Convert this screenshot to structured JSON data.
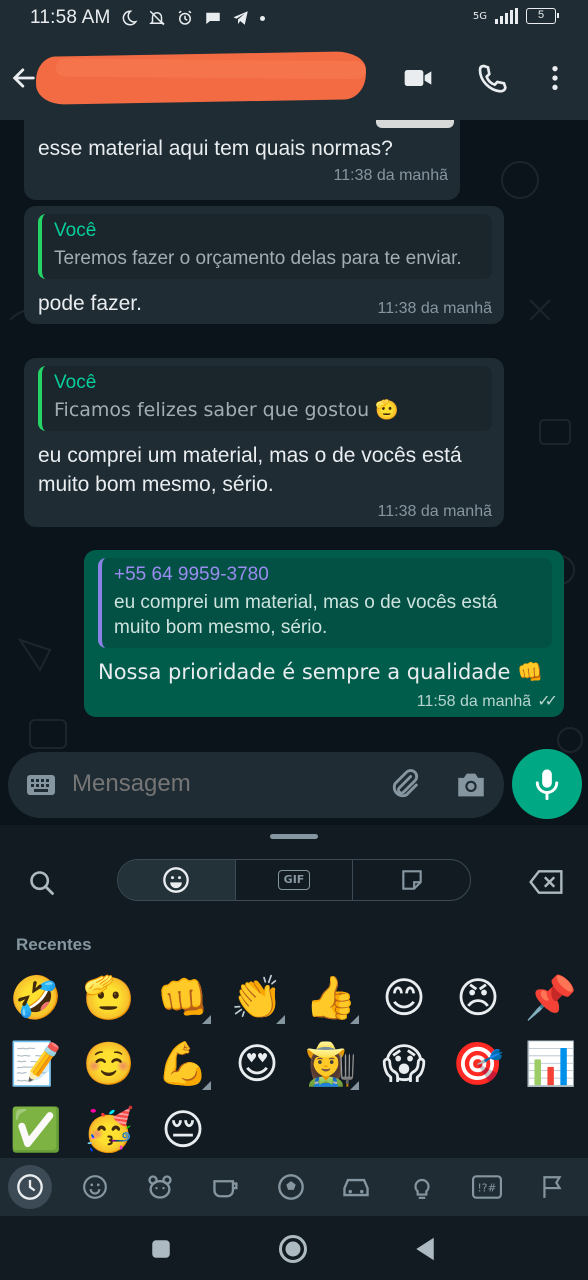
{
  "status_bar": {
    "time": "11:58 AM",
    "network": "5G",
    "battery": "5"
  },
  "header": {
    "contact_name_redacted": true
  },
  "messages": [
    {
      "direction": "in",
      "text": "esse material aqui tem quais normas?",
      "time": "11:38 da manhã"
    },
    {
      "direction": "in",
      "quote_author": "Você",
      "quote_text": "Teremos fazer o orçamento delas para te enviar.",
      "text": "pode fazer.",
      "time": "11:38 da manhã"
    },
    {
      "direction": "in",
      "quote_author": "Você",
      "quote_text": "Ficamos felizes saber que gostou 🫡",
      "text": "eu comprei um material, mas o de vocês está muito bom mesmo, sério.",
      "time": "11:38 da manhã"
    },
    {
      "direction": "out",
      "quote_author": "+55 64 9959-3780",
      "quote_text": "eu comprei um material, mas o de vocês está muito bom mesmo, sério.",
      "text": "Nossa prioridade é sempre a qualidade 👊",
      "time": "11:58 da manhã"
    }
  ],
  "compose": {
    "placeholder": "Mensagem"
  },
  "emoji_panel": {
    "section_title": "Recentes",
    "gif_label": "GIF",
    "recent": [
      "🤣",
      "🫡",
      "👊",
      "👏",
      "👍",
      "😊",
      "😠",
      "📌",
      "📝",
      "☺️",
      "💪",
      "😍",
      "👩‍🌾",
      "😱",
      "🎯",
      "📊",
      "✅",
      "🥳",
      "😔"
    ]
  },
  "colors": {
    "outgoing_bubble": "#005c4b",
    "incoming_bubble": "#1f2c34",
    "accent": "#00a884",
    "redaction": "#f36b42"
  }
}
